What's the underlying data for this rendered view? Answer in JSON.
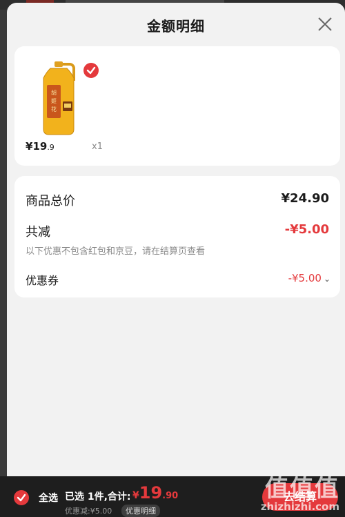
{
  "sheet": {
    "title": "金额明细"
  },
  "product": {
    "price_currency": "¥",
    "price_main": "19",
    "price_decimal": ".9",
    "quantity": "x1"
  },
  "summary": {
    "total_label": "商品总价",
    "total_value": "¥24.90",
    "reduce_label": "共减",
    "reduce_value": "-¥5.00",
    "reduce_note": "以下优惠不包含红包和京豆，请在结算页查看",
    "coupon_label": "优惠券",
    "coupon_value": "-¥5.00"
  },
  "bottom_bar": {
    "select_all_label": "全选",
    "selected_info": "已选 1件,合计:",
    "total_currency": "¥",
    "total_main": "19",
    "total_decimal": ".90",
    "discount_line": "优惠减:¥5.00",
    "detail_button": "优惠明细",
    "checkout_button": "去结算"
  },
  "watermark": {
    "logo": "值值值",
    "url": "zhizhizhi.com"
  },
  "colors": {
    "accent": "#e4393c",
    "sheet_bg": "#f2f2f2",
    "bar_bg": "#1e1e1e"
  },
  "icons": [
    "close-icon",
    "check-icon",
    "chevron-down-icon",
    "oil-bottle-image"
  ]
}
